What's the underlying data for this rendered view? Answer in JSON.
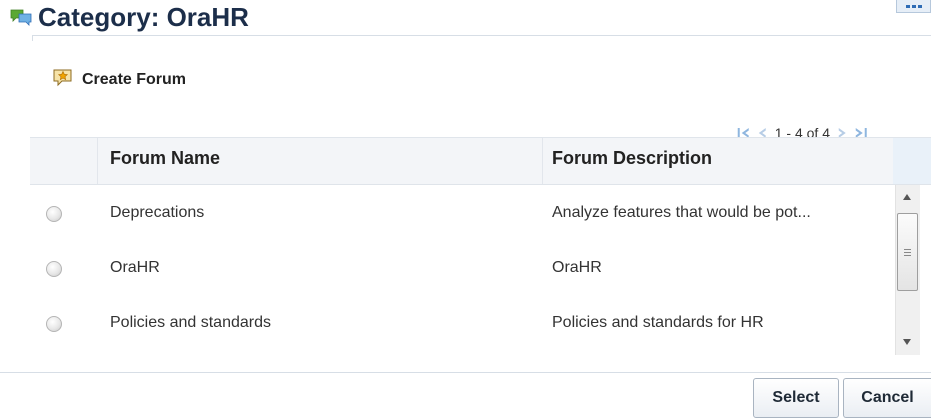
{
  "header": {
    "title": "Category: OraHR",
    "category_icon": "forum-category-icon",
    "menu_icon": "more-options-icon"
  },
  "toolbar": {
    "create_forum_label": "Create Forum",
    "create_forum_icon": "create-forum-icon"
  },
  "pagination": {
    "range_label": "1 - 4 of 4",
    "first_icon": "first-page-icon",
    "prev_icon": "previous-page-icon",
    "next_icon": "next-page-icon",
    "last_icon": "last-page-icon"
  },
  "table": {
    "columns": [
      "Forum Name",
      "Forum Description"
    ],
    "rows": [
      {
        "name": "Deprecations",
        "description": "Analyze features that would be pot...",
        "selected": false
      },
      {
        "name": "OraHR",
        "description": "OraHR",
        "selected": false
      },
      {
        "name": "Policies and standards",
        "description": "Policies and standards for HR",
        "selected": false
      }
    ]
  },
  "footer": {
    "select_label": "Select",
    "cancel_label": "Cancel"
  },
  "colors": {
    "title": "#1c2e4a",
    "header_bg": "#f3f5f8",
    "accent_blue": "#2e6cb5",
    "icon_green": "#4a9e2b"
  }
}
